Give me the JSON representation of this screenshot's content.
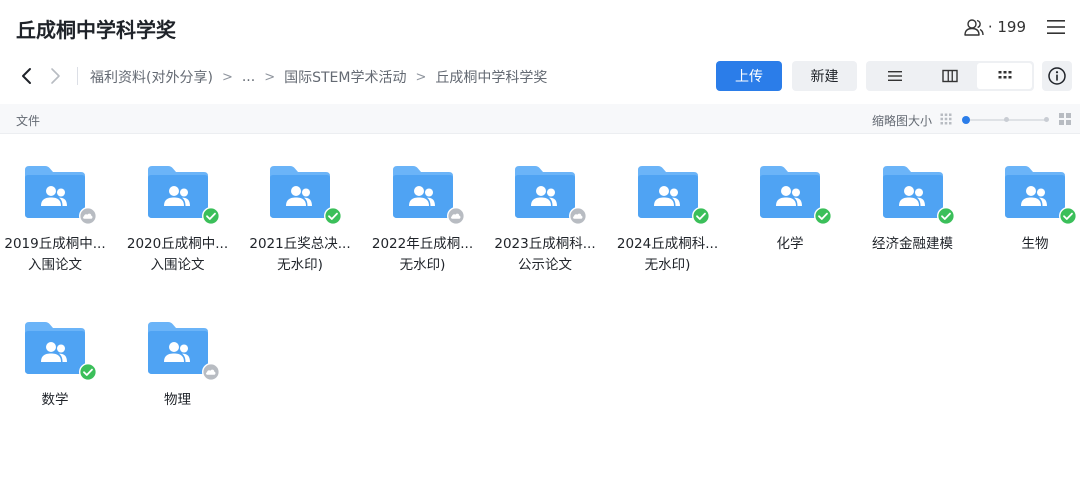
{
  "header": {
    "title": "丘成桐中学科学奖",
    "member_count": "· 199",
    "member_icon": "users-icon",
    "menu_icon": "hamburger-menu-icon"
  },
  "nav": {
    "back_icon": "chevron-left-icon",
    "forward_icon": "chevron-right-icon"
  },
  "breadcrumb": {
    "items": [
      "福利资料(对外分享)",
      "...",
      "国际STEM学术活动",
      "丘成桐中学科学奖"
    ],
    "separator": ">"
  },
  "toolbar": {
    "upload_label": "上传",
    "new_label": "新建",
    "view_modes": [
      "list-view-icon",
      "column-view-icon",
      "grid-view-icon"
    ],
    "active_view": "grid",
    "info_icon": "info-icon"
  },
  "subheader": {
    "files_label": "文件",
    "thumbnail_size_label": "缩略图大小",
    "thumbnail_level": 0
  },
  "colors": {
    "accent": "#2b7de9",
    "folder": "#5aa9f5",
    "synced": "#3bbf5a",
    "cloud": "#b8bcc2"
  },
  "files": [
    {
      "name": "2019丘成桐中...入围论文",
      "status": "cloud"
    },
    {
      "name": "2020丘成桐中...入围论文",
      "status": "synced"
    },
    {
      "name": "2021丘奖总决...无水印)",
      "status": "synced"
    },
    {
      "name": "2022年丘成桐...无水印)",
      "status": "cloud"
    },
    {
      "name": "2023丘成桐科...公示论文",
      "status": "cloud"
    },
    {
      "name": "2024丘成桐科...无水印)",
      "status": "synced"
    },
    {
      "name": "化学",
      "status": "synced"
    },
    {
      "name": "经济金融建模",
      "status": "synced"
    },
    {
      "name": "生物",
      "status": "synced"
    },
    {
      "name": "数学",
      "status": "synced"
    },
    {
      "name": "物理",
      "status": "cloud"
    }
  ]
}
